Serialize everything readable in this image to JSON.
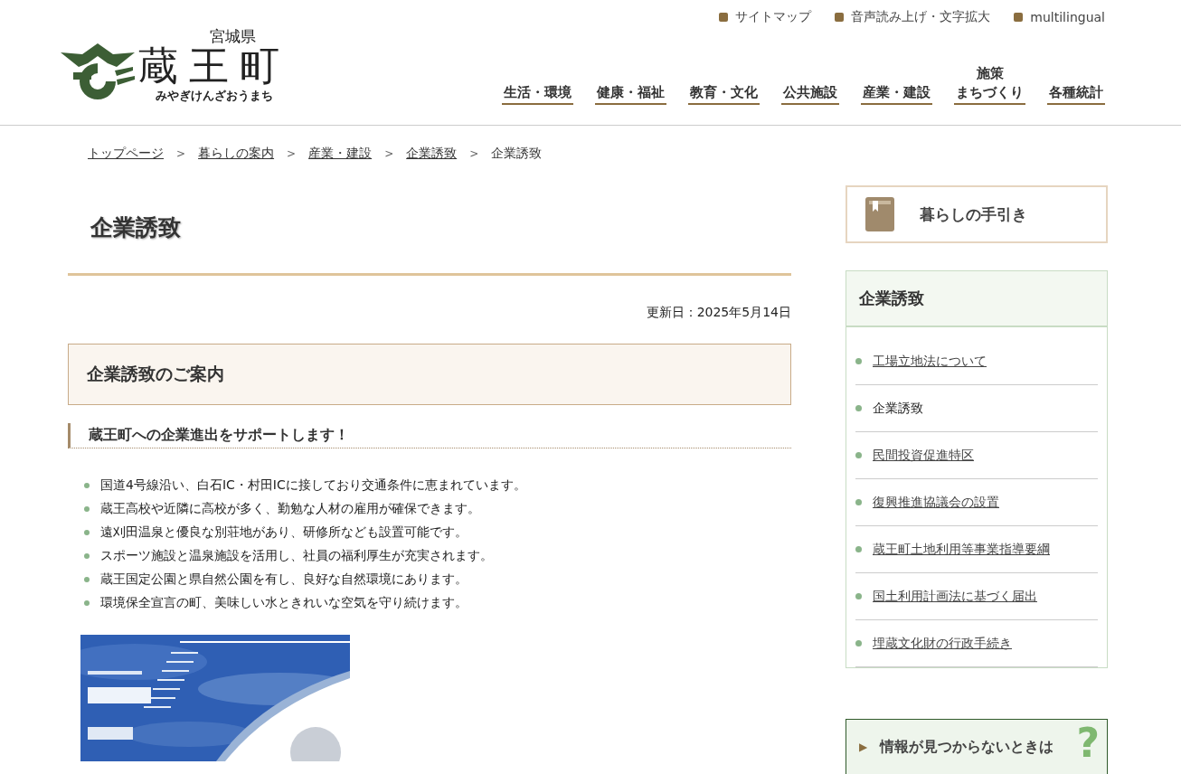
{
  "utility_links": [
    "サイトマップ",
    "音声読み上げ・文字拡大",
    "multilingual"
  ],
  "logo": {
    "prefecture": "宮城県",
    "town": "蔵王町",
    "reading": "みやぎけんざおうまち"
  },
  "nav": [
    {
      "lines": [
        "生活・環境"
      ]
    },
    {
      "lines": [
        "健康・福祉"
      ]
    },
    {
      "lines": [
        "教育・文化"
      ]
    },
    {
      "lines": [
        "公共施設"
      ]
    },
    {
      "lines": [
        "産業・建設"
      ]
    },
    {
      "lines": [
        "施策",
        "まちづくり"
      ]
    },
    {
      "lines": [
        "各種統計"
      ]
    }
  ],
  "breadcrumb": [
    {
      "label": "トップページ",
      "current": false
    },
    {
      "label": "暮らしの案内",
      "current": false
    },
    {
      "label": "産業・建設",
      "current": false
    },
    {
      "label": "企業誘致",
      "current": false
    },
    {
      "label": "企業誘致",
      "current": true
    }
  ],
  "breadcrumb_separator": ">",
  "page_title": "企業誘致",
  "updated": "更新日：2025年5月14日",
  "section_heading": "企業誘致のご案内",
  "subheading": "蔵王町への企業進出をサポートします！",
  "points": [
    "国道4号線沿い、白石IC・村田ICに接しており交通条件に恵まれています。",
    "蔵王高校や近隣に高校が多く、勤勉な人材の雇用が確保できます。",
    "遠刈田温泉と優良な別荘地があり、研修所なども設置可能です。",
    "スポーツ施設と温泉施設を活用し、社員の福利厚生が充実されます。",
    "蔵王国定公園と県自然公園を有し、良好な自然環境にあります。",
    "環境保全宣言の町、美味しい水ときれいな空気を守り続けます。"
  ],
  "image": {
    "kind": "picture"
  },
  "guide_button": "暮らしの手引き",
  "side_menu": {
    "title": "企業誘致",
    "items": [
      {
        "label": "工場立地法について",
        "selected": false
      },
      {
        "label": "企業誘致",
        "selected": true
      },
      {
        "label": "民間投資促進特区",
        "selected": false
      },
      {
        "label": "復興推進協議会の設置",
        "selected": false
      },
      {
        "label": "蔵王町土地利用等事業指導要綱",
        "selected": false
      },
      {
        "label": "国土利用計画法に基づく届出",
        "selected": false
      },
      {
        "label": "埋蔵文化財の行政手続き",
        "selected": false
      }
    ]
  },
  "help_box": {
    "marker": "▶",
    "label": "情報が見つからないときは",
    "mark": "?"
  }
}
